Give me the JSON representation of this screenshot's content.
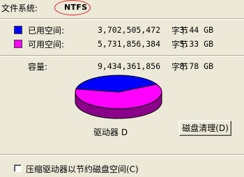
{
  "filesystem": {
    "label": "文件系统:",
    "value": "NTFS"
  },
  "used": {
    "label": "已用空间:",
    "bytes": "3,702,505,472",
    "unit": "字节",
    "size": "3.44 GB",
    "color": "#0000ff"
  },
  "free": {
    "label": "可用空间:",
    "bytes": "5,731,856,384",
    "unit": "字节",
    "size": "5.33 GB",
    "color": "#ff00ff"
  },
  "capacity": {
    "label": "容量:",
    "bytes": "9,434,361,856",
    "unit": "字节",
    "size": "8.78 GB"
  },
  "drive_label": "驱动器 D",
  "cleanup_button": "磁盘清理(D)",
  "compress_checkbox": {
    "label": "压缩驱动器以节约磁盘空间(C)",
    "checked": false
  },
  "pie": {
    "used_fraction": 0.3924,
    "free_fraction": 0.6076
  }
}
